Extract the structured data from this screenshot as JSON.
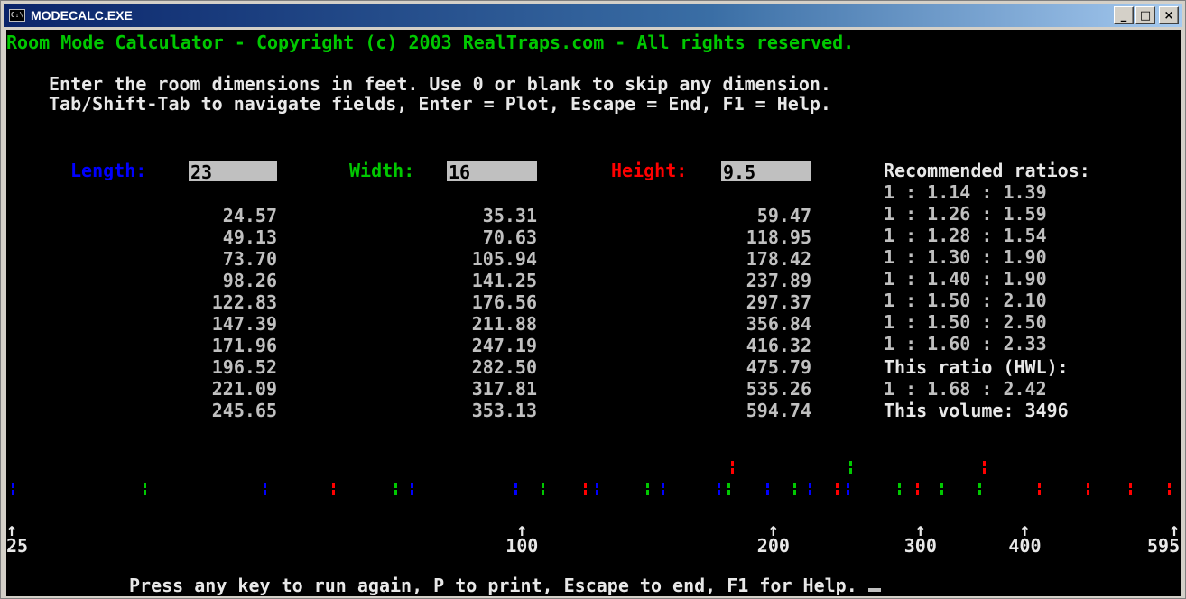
{
  "window": {
    "title": "MODECALC.EXE",
    "icon_label": "C:\\",
    "buttons": {
      "minimize": "_",
      "maximize": "□",
      "close": "×"
    }
  },
  "header": "Room Mode Calculator - Copyright (c) 2003 RealTraps.com - All rights reserved.",
  "instructions": [
    "Enter the room dimensions in feet. Use 0 or blank to skip any dimension.",
    "Tab/Shift-Tab to navigate fields, Enter = Plot, Escape = End, F1 = Help."
  ],
  "fields": {
    "length": {
      "label": "Length:",
      "value": "23",
      "color": "#0000ff"
    },
    "width": {
      "label": "Width:",
      "value": "16",
      "color": "#00c800"
    },
    "height": {
      "label": "Height:",
      "value": "9.5",
      "color": "#ff0000"
    }
  },
  "modes": {
    "length": [
      "24.57",
      "49.13",
      "73.70",
      "98.26",
      "122.83",
      "147.39",
      "171.96",
      "196.52",
      "221.09",
      "245.65"
    ],
    "width": [
      "35.31",
      "70.63",
      "105.94",
      "141.25",
      "176.56",
      "211.88",
      "247.19",
      "282.50",
      "317.81",
      "353.13"
    ],
    "height": [
      "59.47",
      "118.95",
      "178.42",
      "237.89",
      "297.37",
      "356.84",
      "416.32",
      "475.79",
      "535.26",
      "594.74"
    ]
  },
  "ratios": {
    "heading": "Recommended ratios:",
    "items": [
      "1 : 1.14 : 1.39",
      "1 : 1.26 : 1.59",
      "1 : 1.28 : 1.54",
      "1 : 1.30 : 1.90",
      "1 : 1.40 : 1.90",
      "1 : 1.50 : 2.10",
      "1 : 1.50 : 2.50",
      "1 : 1.60 : 2.33"
    ],
    "this_ratio_label": "This ratio (HWL):",
    "this_ratio_value": "1 : 1.68 : 2.42",
    "this_volume": "This volume: 3496"
  },
  "axis": {
    "ticks": [
      "25",
      "100",
      "200",
      "300",
      "400",
      "595"
    ],
    "scale": "log",
    "range": [
      25,
      595
    ]
  },
  "footer": "Press any key to run again, P to print, Escape to end, F1 for Help.",
  "colors": {
    "length": "#0000ff",
    "width": "#00c800",
    "height": "#ff0000",
    "text": "#c0c0c0",
    "header": "#00c800"
  }
}
